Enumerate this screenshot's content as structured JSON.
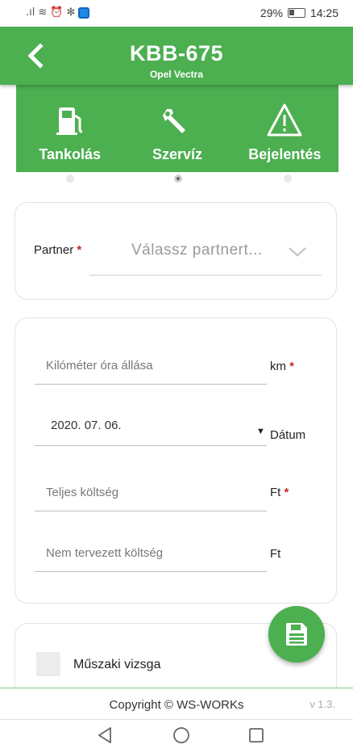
{
  "status_bar": {
    "battery_text": "29%",
    "time": "14:25"
  },
  "header": {
    "plate": "KBB-675",
    "model": "Opel Vectra"
  },
  "tabs": [
    {
      "label": "Tankolás",
      "icon": "fuel-pump-icon"
    },
    {
      "label": "Szervíz",
      "icon": "wrench-icon"
    },
    {
      "label": "Bejelentés",
      "icon": "warning-icon"
    }
  ],
  "active_tab_index": 1,
  "partner": {
    "label": "Partner",
    "required_mark": "*",
    "placeholder": "Válassz partnert..."
  },
  "fields": {
    "odometer": {
      "placeholder": "Kilóméter óra állása",
      "unit": "km",
      "required_mark": "*"
    },
    "date": {
      "value": "2020. 07. 06.",
      "caret": "▼",
      "label": "Dátum"
    },
    "total_cost": {
      "placeholder": "Teljes költség",
      "unit": "Ft",
      "required_mark": "*"
    },
    "unplanned_cost": {
      "placeholder": "Nem tervezett költség",
      "unit": "Ft"
    }
  },
  "checkbox": {
    "label": "Műszaki vizsga",
    "checked": false
  },
  "footer": {
    "copyright": "Copyright © WS-WORKs",
    "version": "v 1.3."
  },
  "colors": {
    "primary": "#4caf50",
    "required": "#c62828"
  }
}
